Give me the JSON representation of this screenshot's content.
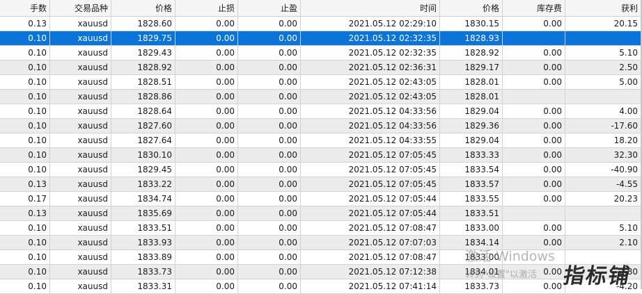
{
  "columns": [
    "手数",
    "交易品种",
    "价格",
    "止损",
    "止盈",
    "时间",
    "价格",
    "库存费",
    "获利"
  ],
  "rows": [
    [
      "0.13",
      "xauusd",
      "1828.60",
      "0.00",
      "0.00",
      "2021.05.12 02:29:10",
      "1830.15",
      "0.00",
      "20.15"
    ],
    [
      "0.10",
      "xauusd",
      "1829.75",
      "0.00",
      "0.00",
      "2021.05.12 02:32:35",
      "1828.93",
      "",
      ""
    ],
    [
      "0.10",
      "xauusd",
      "1829.43",
      "0.00",
      "0.00",
      "2021.05.12 02:32:35",
      "1828.92",
      "0.00",
      "5.10"
    ],
    [
      "0.10",
      "xauusd",
      "1828.92",
      "0.00",
      "0.00",
      "2021.05.12 02:36:31",
      "1829.17",
      "0.00",
      "2.50"
    ],
    [
      "0.10",
      "xauusd",
      "1828.51",
      "0.00",
      "0.00",
      "2021.05.12 02:43:05",
      "1828.01",
      "0.00",
      "5.00"
    ],
    [
      "0.10",
      "xauusd",
      "1828.86",
      "0.00",
      "0.00",
      "2021.05.12 02:43:05",
      "1828.01",
      "",
      ""
    ],
    [
      "0.10",
      "xauusd",
      "1828.64",
      "0.00",
      "0.00",
      "2021.05.12 04:33:56",
      "1829.04",
      "0.00",
      "4.00"
    ],
    [
      "0.10",
      "xauusd",
      "1827.60",
      "0.00",
      "0.00",
      "2021.05.12 04:33:56",
      "1829.36",
      "0.00",
      "-17.60"
    ],
    [
      "0.10",
      "xauusd",
      "1827.64",
      "0.00",
      "0.00",
      "2021.05.12 04:33:55",
      "1829.04",
      "0.00",
      "18.20"
    ],
    [
      "0.10",
      "xauusd",
      "1830.10",
      "0.00",
      "0.00",
      "2021.05.12 07:05:45",
      "1833.33",
      "0.00",
      "32.30"
    ],
    [
      "0.10",
      "xauusd",
      "1829.45",
      "0.00",
      "0.00",
      "2021.05.12 07:05:45",
      "1833.54",
      "0.00",
      "-40.90"
    ],
    [
      "0.13",
      "xauusd",
      "1833.22",
      "0.00",
      "0.00",
      "2021.05.12 07:05:45",
      "1833.57",
      "0.00",
      "-4.55"
    ],
    [
      "0.17",
      "xauusd",
      "1834.74",
      "0.00",
      "0.00",
      "2021.05.12 07:05:44",
      "1833.55",
      "0.00",
      "20.23"
    ],
    [
      "0.13",
      "xauusd",
      "1835.69",
      "0.00",
      "0.00",
      "2021.05.12 07:05:44",
      "1833.51",
      "",
      ""
    ],
    [
      "0.10",
      "xauusd",
      "1833.51",
      "0.00",
      "0.00",
      "2021.05.12 07:08:47",
      "1833.00",
      "0.00",
      "5.10"
    ],
    [
      "0.10",
      "xauusd",
      "1833.93",
      "0.00",
      "0.00",
      "2021.05.12 07:07:03",
      "1834.14",
      "0.00",
      "2.10"
    ],
    [
      "0.10",
      "xauusd",
      "1833.89",
      "0.00",
      "0.00",
      "2021.05.12 07:08:47",
      "1833.00",
      "",
      ""
    ],
    [
      "0.10",
      "xauusd",
      "1833.73",
      "0.00",
      "0.00",
      "2021.05.12 07:12:38",
      "1834.01",
      "0.00",
      "-2.80"
    ],
    [
      "0.10",
      "xauusd",
      "1833.31",
      "0.00",
      "0.00",
      "2021.05.12 07:41:14",
      "1833.73",
      "0.00",
      "-4.20"
    ]
  ],
  "selected_row": 1,
  "watermark": {
    "line1": "激活 Windows",
    "line2": "转到\"设置\"以激活"
  },
  "logo_text": "指标铺",
  "colors": {
    "selected": "#0a74da",
    "alt_row": "#ececec",
    "header_bg": "#f5f5f5"
  }
}
